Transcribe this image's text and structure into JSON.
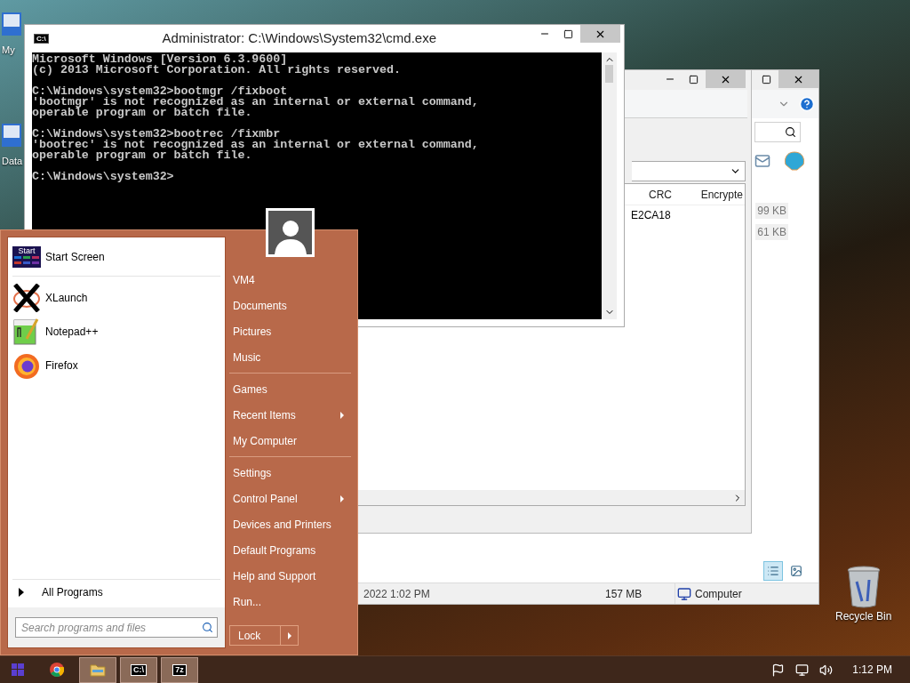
{
  "desktop_icons": [
    {
      "label": "My"
    },
    {
      "label": "Data"
    }
  ],
  "recycle_bin": {
    "label": "Recycle Bin"
  },
  "back_window": {
    "size_cells": [
      "99 KB",
      "61 KB"
    ],
    "status_date": "2022 1:02 PM",
    "status_size": "157 MB",
    "status_location": "Computer",
    "views": [
      {
        "selected": true
      },
      {
        "selected": false
      }
    ]
  },
  "middle_window": {
    "columns": [
      "CRC",
      "Encrypte"
    ],
    "rows": [
      [
        "E2CA18"
      ]
    ]
  },
  "cmd": {
    "icon_text": "C:\\",
    "title": "Administrator: C:\\Windows\\System32\\cmd.exe",
    "blocks": [
      [
        "Microsoft Windows [Version 6.3.9600]",
        "(c) 2013 Microsoft Corporation. All rights reserved."
      ],
      [
        "C:\\Windows\\system32>bootmgr /fixboot",
        "'bootmgr' is not recognized as an internal or external command,",
        "operable program or batch file."
      ],
      [
        "C:\\Windows\\system32>bootrec /fixmbr",
        "'bootrec' is not recognized as an internal or external command,",
        "operable program or batch file."
      ],
      [
        "C:\\Windows\\system32>"
      ]
    ]
  },
  "start_menu": {
    "pinned": [
      {
        "kind": "start",
        "label": "Start Screen",
        "icon_text": "Start"
      }
    ],
    "programs": [
      {
        "kind": "x",
        "label": "XLaunch"
      },
      {
        "kind": "notepad",
        "label": "Notepad++"
      },
      {
        "kind": "firefox",
        "label": "Firefox"
      }
    ],
    "all_programs": "All Programs",
    "search": {
      "placeholder": "Search programs and files"
    },
    "place_groups": [
      [
        {
          "label": "VM4",
          "submenu": false
        },
        {
          "label": "Documents",
          "submenu": false
        },
        {
          "label": "Pictures",
          "submenu": false
        },
        {
          "label": "Music",
          "submenu": false
        }
      ],
      [
        {
          "label": "Games",
          "submenu": false
        },
        {
          "label": "Recent Items",
          "submenu": true
        },
        {
          "label": "My Computer",
          "submenu": false
        }
      ],
      [
        {
          "label": "Settings",
          "submenu": false
        },
        {
          "label": "Control Panel",
          "submenu": true
        },
        {
          "label": "Devices and Printers",
          "submenu": false
        },
        {
          "label": "Default Programs",
          "submenu": false
        },
        {
          "label": "Help and Support",
          "submenu": false
        },
        {
          "label": "Run...",
          "submenu": false
        }
      ]
    ],
    "lock": "Lock"
  },
  "taskbar": {
    "apps": [
      {
        "kind": "chrome",
        "running": false
      },
      {
        "kind": "explorer",
        "running": true
      },
      {
        "kind": "cmd",
        "running": true,
        "icon_text": "C:\\"
      },
      {
        "kind": "zip",
        "running": true,
        "icon_text": "7z"
      }
    ],
    "clock": "1:12 PM"
  }
}
